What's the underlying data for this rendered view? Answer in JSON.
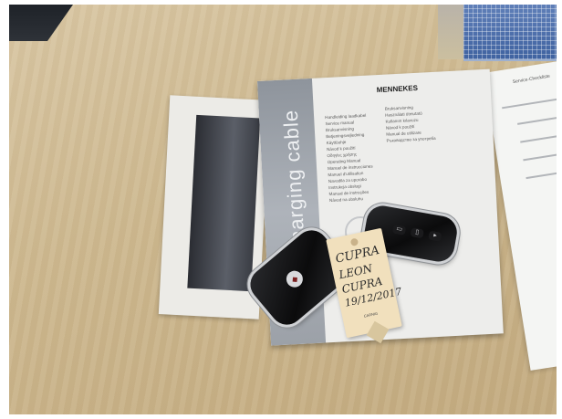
{
  "scene": {
    "manual": {
      "title": "charging cable",
      "brand": "MENNEKES",
      "languages_left": [
        "Handleiding laadkabel",
        "Service manual",
        "Bruksanvisning",
        "Betjeningsvejledning",
        "Käyttöohje",
        "Návod k použití",
        "Οδηγίες χρήσης",
        "Operating Manual",
        "Manuel de instrucciones",
        "Manuel d'utilisation",
        "Navodila za uporabo",
        "Instrukcja obsługi",
        "Manual de instruções",
        "Návod na obsluhu"
      ],
      "languages_right": [
        "Bruksanvisning",
        "Használati útmutató",
        "Kullanım kılavuzu",
        "Návod k použití",
        "Manual de utilizare",
        "Ръководство за употреба"
      ]
    },
    "tag": {
      "line1": "CUPRA",
      "line2": "LEON",
      "line3": "CUPRA",
      "line4": "19/12/2017",
      "dealer": "CARNIG"
    },
    "paper": {
      "heading": "Service-Checkliste"
    }
  }
}
